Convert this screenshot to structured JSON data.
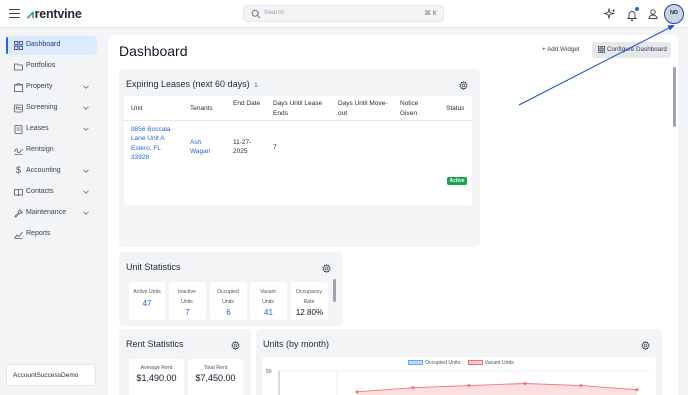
{
  "header": {
    "brand": "rentvine",
    "search_placeholder": "Search",
    "search_shortcut": "⌘ K",
    "icons": [
      "sparkle-icon",
      "bell-icon",
      "user-icon"
    ],
    "avatar_initials": "ND"
  },
  "sidebar": {
    "items": [
      {
        "label": "Dashboard",
        "icon": "grid-icon",
        "active": true,
        "expandable": false
      },
      {
        "label": "Portfolios",
        "icon": "folder-icon",
        "active": false,
        "expandable": false
      },
      {
        "label": "Property",
        "icon": "building-icon",
        "active": false,
        "expandable": true
      },
      {
        "label": "Screening",
        "icon": "screening-icon",
        "active": false,
        "expandable": true
      },
      {
        "label": "Leases",
        "icon": "leases-icon",
        "active": false,
        "expandable": true
      },
      {
        "label": "Rentsign",
        "icon": "signature-icon",
        "active": false,
        "expandable": false
      },
      {
        "label": "Accounting",
        "icon": "dollar-icon",
        "active": false,
        "expandable": true
      },
      {
        "label": "Contacts",
        "icon": "contacts-icon",
        "active": false,
        "expandable": true
      },
      {
        "label": "Maintenance",
        "icon": "wrench-icon",
        "active": false,
        "expandable": true
      },
      {
        "label": "Reports",
        "icon": "reports-icon",
        "active": false,
        "expandable": false
      }
    ],
    "account": "AccountSuccessDemo"
  },
  "page": {
    "title": "Dashboard",
    "add_widget": "Add Widget",
    "configure": "Configure Dashboard"
  },
  "expiring_leases": {
    "title": "Expiring Leases (next 60 days)",
    "count": "1",
    "headers": [
      "Unit",
      "Tenants",
      "End Date",
      "Days Until Lease Ends",
      "Days Until Move-out",
      "Notice Given",
      "Status"
    ],
    "rows": [
      {
        "unit": "9856 Boccala Lane Unit A Estero, FL 33928",
        "tenant": "Ash Wagan",
        "end_date": "11-27-2025",
        "days_until_lease_ends": "7",
        "days_until_move_out": "",
        "notice_given": "",
        "status": "Active"
      }
    ]
  },
  "unit_statistics": {
    "title": "Unit Statistics",
    "stats": [
      {
        "label": "Active Units",
        "value": "47"
      },
      {
        "label": "Inactive Units",
        "value": "7"
      },
      {
        "label": "Occupied Units",
        "value": "6"
      },
      {
        "label": "Vacant Units",
        "value": "41"
      },
      {
        "label": "Occupancy Rate",
        "value": "12.80%"
      }
    ]
  },
  "rent_statistics": {
    "title": "Rent Statistics",
    "boxes": [
      {
        "label": "Average Rent",
        "value": "$1,490.00"
      },
      {
        "label": "Total Rent",
        "value": "$7,450.00"
      }
    ]
  },
  "units_by_month": {
    "title": "Units (by month)",
    "legend": [
      "Occupied Units",
      "Vacant Units"
    ],
    "colors": {
      "occupied": "#bfdbfe",
      "vacant": "#fecaca",
      "vacant_line": "#f87171"
    }
  },
  "chart_data": {
    "type": "area",
    "title": "Units (by month)",
    "series": [
      {
        "name": "Occupied Units",
        "values": []
      },
      {
        "name": "Vacant Units",
        "values": [
          40,
          42,
          43,
          44,
          43,
          41
        ]
      }
    ],
    "yticks": [
      "50"
    ],
    "grid": true,
    "legend_position": "top"
  },
  "annotation": {
    "arrow_color": "#1d4ed8"
  }
}
